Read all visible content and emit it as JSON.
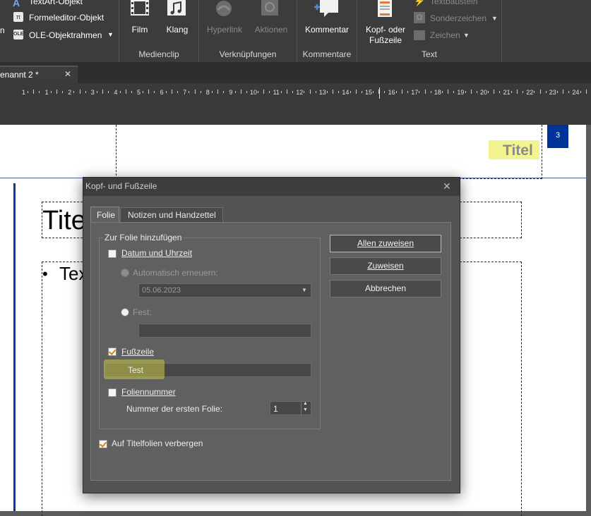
{
  "ribbon": {
    "insert_objects": {
      "textart": "TextArt-Objekt",
      "formula": "Formeleditor-Objekt",
      "ole": "OLE-Objektrahmen"
    },
    "media": {
      "film": "Film",
      "sound": "Klang",
      "group": "Medienclip"
    },
    "links": {
      "hyperlink": "Hyperlink",
      "actions": "Aktionen",
      "group": "Verknüpfungen"
    },
    "comments": {
      "comment": "Kommentar",
      "group": "Kommentare"
    },
    "text": {
      "header_footer": "Kopf- oder\nFußzeile",
      "textbaustein": "Textbaustein",
      "special_chars": "Sonderzeichen",
      "chars": "Zeichen",
      "group": "Text"
    }
  },
  "tab": {
    "label": "enannt 2 *",
    "close": "✕"
  },
  "ruler": {
    "numbers": [
      "1",
      "1",
      "2",
      "3",
      "4",
      "5",
      "6",
      "7",
      "8",
      "9",
      "10",
      "11",
      "12",
      "13",
      "14",
      "15",
      "16",
      "17",
      "18",
      "19",
      "20",
      "21",
      "22",
      "23",
      "24",
      "25"
    ]
  },
  "slide": {
    "page_number": "3",
    "header_title": "Titel",
    "title": "Titel",
    "bullet": "•",
    "body": "Tex"
  },
  "dialog": {
    "title": "Kopf- und Fußzeile",
    "close": "✕",
    "tabs": [
      "Folie",
      "Notizen und Handzettel"
    ],
    "group_label": "Zur Folie hinzufügen",
    "date_label": "Datum und Uhrzeit",
    "auto_update": "Automatisch erneuern:",
    "date_value": "05.06.2023",
    "fixed": "Fest:",
    "footer_label": "Fußzeile",
    "footer_value": "Test",
    "slide_number": "Foliennummer",
    "first_slide_label": "Nummer der ersten Folie:",
    "first_slide_value": "1",
    "hide_on_title": "Auf Titelfolien verbergen",
    "buttons": {
      "apply_all": "Allen zuweisen",
      "apply": "Zuweisen",
      "cancel": "Abbrechen"
    }
  },
  "colors": {
    "highlight": "#f3f48f",
    "accent_blue": "#003399",
    "check_orange": "#d9801f"
  }
}
